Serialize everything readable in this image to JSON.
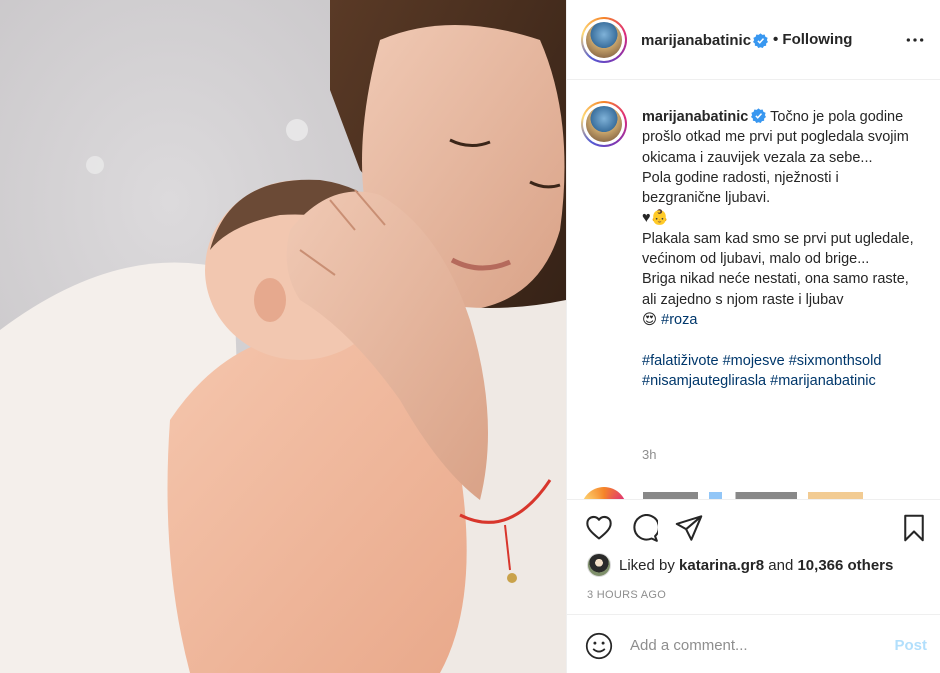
{
  "post": {
    "image_alt": "",
    "username": "marijanabatinic",
    "verified": true,
    "follow_status": "• Following",
    "more_icon": "ellipsis-icon"
  },
  "caption": {
    "username": "marijanabatinic",
    "text": "Točno je pola godine prošlo otkad me prvi put pogledala svojim okicama i zauvijek vezala za sebe...\nPola godine radosti, nježnosti i bezgranične ljubavi.\n♥👶\nPlakala sam kad smo se prvi put ugledale, većinom od ljubavi, malo od brige...\nBriga nikad neće nestati, ona samo raste, ali zajedno s njom raste i ljubav\n😍 ",
    "inline_tag": "#roza",
    "hashtags": [
      "#falatiživote",
      "#mojesve",
      "#sixmonthsold",
      "#nisamjauteglirasla",
      "#marijanabatinic"
    ],
    "age": "3h"
  },
  "actions": {
    "like_icon": "heart-icon",
    "comment_icon": "comment-icon",
    "share_icon": "paper-plane-icon",
    "save_icon": "bookmark-icon"
  },
  "likes": {
    "prefix": "Liked by",
    "user": "katarina.gr8",
    "middle": "and",
    "others": "10,366 others"
  },
  "timestamp": "3 HOURS AGO",
  "comment_box": {
    "placeholder": "Add a comment...",
    "post_label": "Post"
  },
  "colors": {
    "verified": "#3897f0",
    "hashtag": "#00376b",
    "post_disabled": "#b2dffc",
    "meta": "#8e8e8e"
  }
}
